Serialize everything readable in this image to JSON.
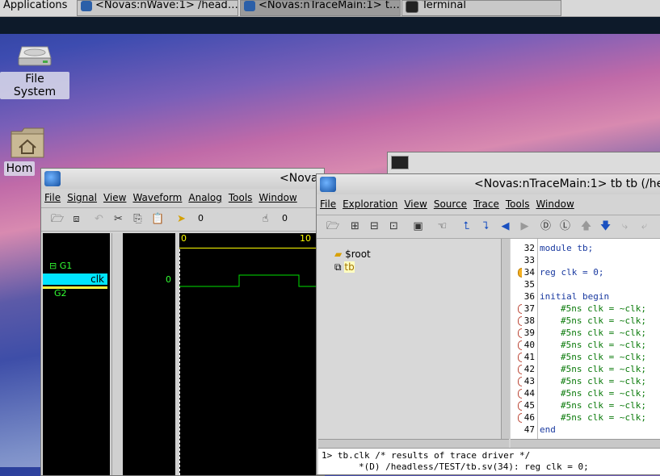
{
  "panel": {
    "apps_label": "Applications",
    "tasks": [
      {
        "label": "<Novas:nWave:1> /head…",
        "icon": "nwave-icon",
        "active": false
      },
      {
        "label": "<Novas:nTraceMain:1> t…",
        "icon": "ntrace-icon",
        "active": true
      },
      {
        "label": "Terminal",
        "icon": "terminal-icon",
        "active": false
      }
    ]
  },
  "desktop": {
    "icons": [
      {
        "label": "File System",
        "icon": "harddisk-icon"
      },
      {
        "label": "Hom",
        "icon": "home-folder-icon"
      }
    ]
  },
  "nwave": {
    "title": "<Nova",
    "menu": [
      "File",
      "Signal",
      "View",
      "Waveform",
      "Analog",
      "Tools",
      "Window"
    ],
    "cursor_time": "0",
    "marker_time": "0",
    "signals": {
      "group1": "G1",
      "clk": "clk",
      "group2": "G2"
    },
    "clk_value": "0",
    "ruler": [
      "0",
      "10"
    ]
  },
  "ntrace": {
    "title": "<Novas:nTraceMain:1> tb tb (/he",
    "menu": [
      "File",
      "Exploration",
      "View",
      "Source",
      "Trace",
      "Tools",
      "Window"
    ],
    "hierarchy": [
      {
        "label": "$root"
      },
      {
        "label": "tb",
        "selected": true
      }
    ],
    "source_lines": [
      {
        "num": "32",
        "text": "module tb;",
        "marker": ""
      },
      {
        "num": "33",
        "text": "",
        "marker": ""
      },
      {
        "num": "34",
        "text": "reg clk = 0;",
        "marker": "highlight"
      },
      {
        "num": "35",
        "text": "",
        "marker": ""
      },
      {
        "num": "36",
        "text": "initial begin",
        "marker": ""
      },
      {
        "num": "37",
        "text": "#5ns clk = ~clk;",
        "marker": "bp"
      },
      {
        "num": "38",
        "text": "#5ns clk = ~clk;",
        "marker": "bp"
      },
      {
        "num": "39",
        "text": "#5ns clk = ~clk;",
        "marker": "bp"
      },
      {
        "num": "40",
        "text": "#5ns clk = ~clk;",
        "marker": "bp"
      },
      {
        "num": "41",
        "text": "#5ns clk = ~clk;",
        "marker": "bp"
      },
      {
        "num": "42",
        "text": "#5ns clk = ~clk;",
        "marker": "bp"
      },
      {
        "num": "43",
        "text": "#5ns clk = ~clk;",
        "marker": "bp"
      },
      {
        "num": "44",
        "text": "#5ns clk = ~clk;",
        "marker": "bp"
      },
      {
        "num": "45",
        "text": "#5ns clk = ~clk;",
        "marker": "bp"
      },
      {
        "num": "46",
        "text": "#5ns clk = ~clk;",
        "marker": "bp"
      },
      {
        "num": "47",
        "text": "end",
        "marker": ""
      }
    ],
    "message_line1": "1> tb.clk /* results of trace driver */",
    "message_line2": "*(D) /headless/TEST/tb.sv(34): reg clk = 0;"
  },
  "colors": {
    "wave_bg": "#000000",
    "wave_green": "#00e000",
    "selected_row": "#00e5ff",
    "signal_yellow": "#ffff40",
    "keyword_blue": "#1a3aa0",
    "code_green": "#0a7a0a"
  }
}
